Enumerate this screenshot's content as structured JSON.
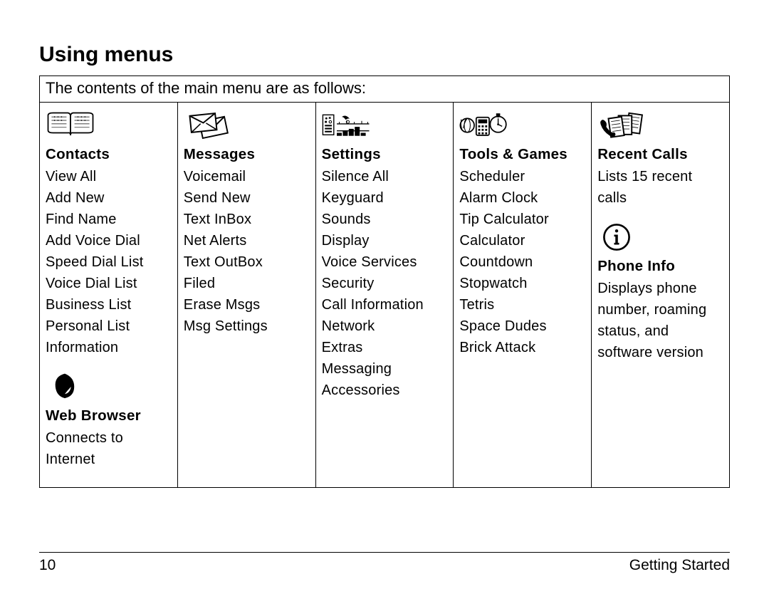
{
  "heading": "Using menus",
  "intro": "The contents of the main menu are as follows:",
  "columns": [
    {
      "blocks": [
        {
          "icon": "book",
          "title": "Contacts",
          "items": [
            "View All",
            "Add New",
            "Find Name",
            "Add Voice Dial",
            "Speed Dial List",
            "Voice Dial List",
            "Business List",
            "Personal List",
            "Information"
          ]
        },
        {
          "icon": "swoosh",
          "title": "Web Browser",
          "desc": "Connects to Internet"
        }
      ]
    },
    {
      "blocks": [
        {
          "icon": "envelopes",
          "title": "Messages",
          "items": [
            "Voicemail",
            "Send New",
            "Text InBox",
            "Net Alerts",
            "Text OutBox",
            "Filed",
            "Erase Msgs",
            "Msg Settings"
          ]
        }
      ]
    },
    {
      "blocks": [
        {
          "icon": "sliders",
          "title": "Settings",
          "items": [
            "Silence All",
            "Keyguard",
            "Sounds",
            "Display",
            "Voice Services",
            "Security",
            "Call Information",
            "Network",
            "Extras",
            "Messaging",
            "Accessories"
          ]
        }
      ]
    },
    {
      "blocks": [
        {
          "icon": "tools",
          "title": "Tools & Games",
          "items": [
            "Scheduler",
            "Alarm Clock",
            "Tip Calculator",
            "Calculator",
            "Countdown",
            "Stopwatch",
            "Tetris",
            "Space Dudes",
            "Brick Attack"
          ]
        }
      ]
    },
    {
      "blocks": [
        {
          "icon": "phone-calls",
          "title": "Recent Calls",
          "desc": "Lists 15 recent calls"
        },
        {
          "icon": "info",
          "title": "Phone Info",
          "desc": "Displays phone number, roaming status, and software version"
        }
      ]
    }
  ],
  "footer": {
    "page": "10",
    "section": "Getting Started"
  }
}
